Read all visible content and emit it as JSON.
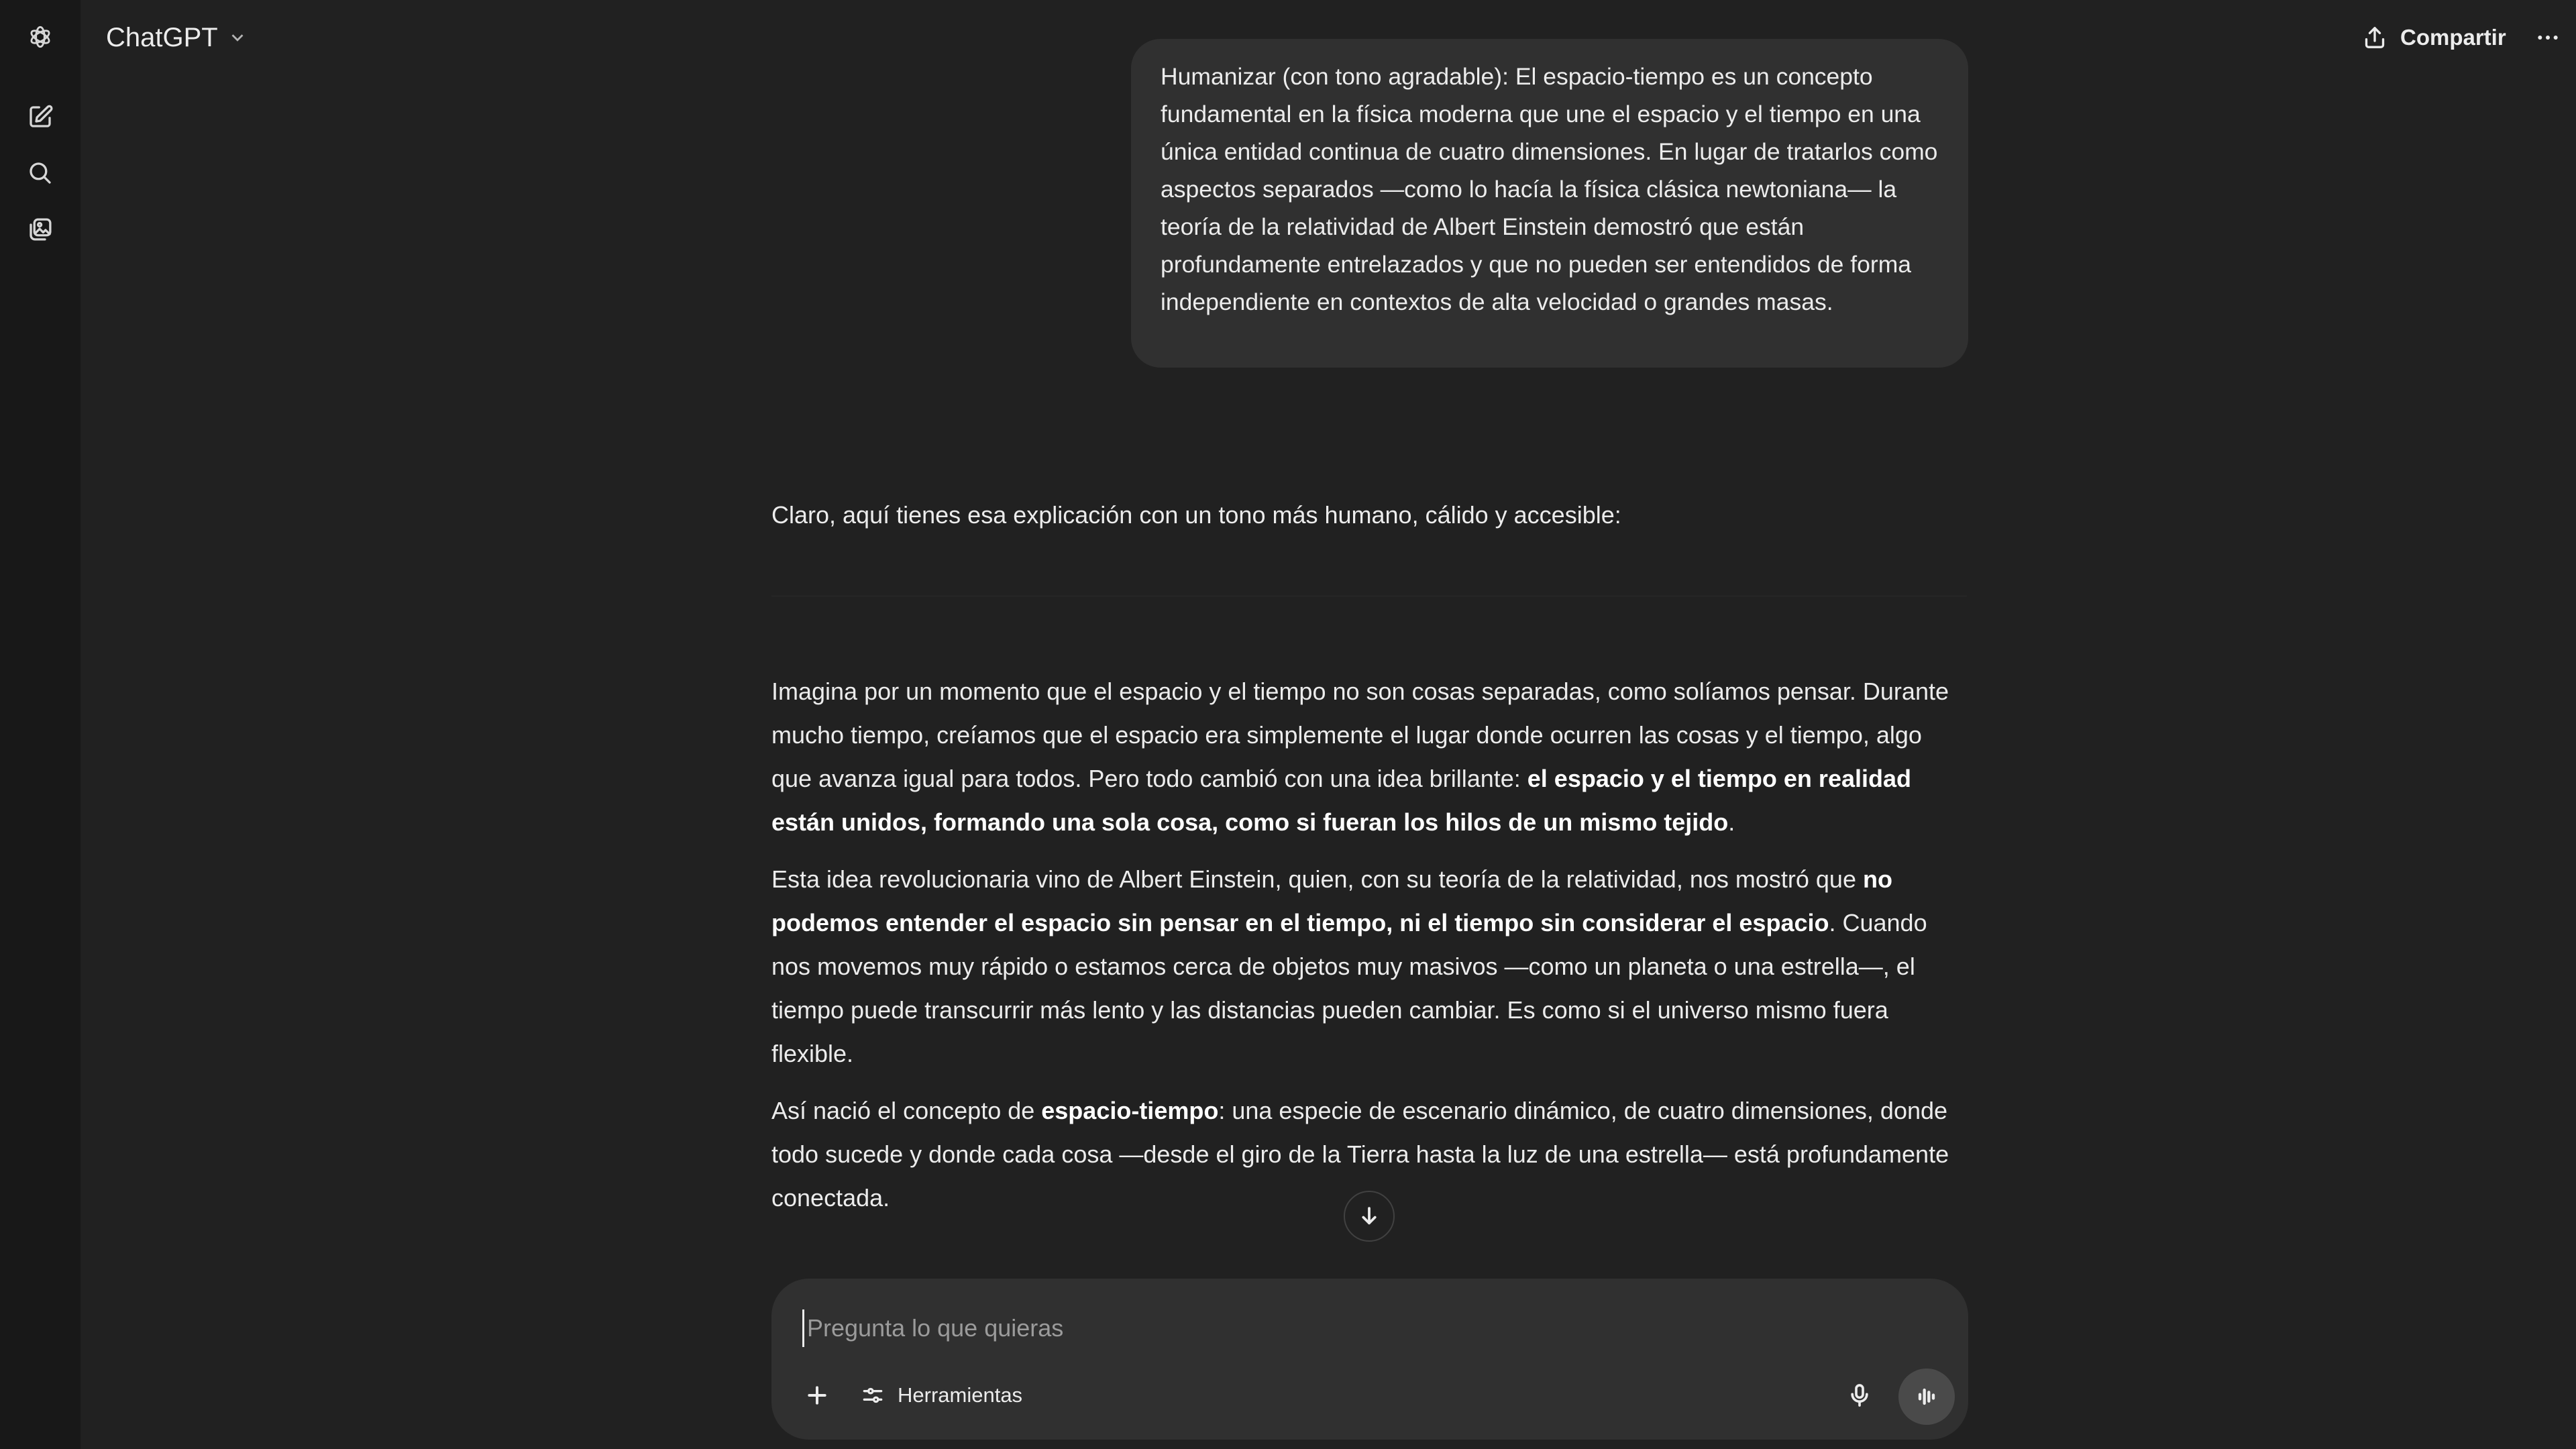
{
  "header": {
    "title": "ChatGPT",
    "share_label": "Compartir",
    "icons": {
      "logo": "openai-logo-icon",
      "new_chat": "edit-pencil-icon",
      "search": "search-icon",
      "library": "image-library-icon",
      "share": "upload-share-icon",
      "more": "more-dots-icon",
      "chevron": "chevron-down-icon"
    }
  },
  "conversation": {
    "user_message": "Humanizar (con tono agradable): El espacio-tiempo es un concepto fundamental en la física moderna que une el espacio y el tiempo en una única entidad continua de cuatro dimensiones. En lugar de tratarlos como aspectos separados —como lo hacía la física clásica newtoniana— la teoría de la relatividad de Albert Einstein demostró que están profundamente entrelazados y que no pueden ser entendidos de forma independiente en contextos de alta velocidad o grandes masas.",
    "assistant_intro": "Claro, aquí tienes esa explicación con un tono más humano, cálido y accesible:",
    "p1": {
      "t1": "Imagina por un momento que el espacio y el tiempo no son cosas separadas, como solíamos pensar. Durante mucho tiempo, creíamos que el espacio era simplemente el lugar donde ocurren las cosas y el tiempo, algo que avanza igual para todos. Pero todo cambió con una idea brillante: ",
      "b1": "el espacio y el tiempo en realidad están unidos, formando una sola cosa, como si fueran los hilos de un mismo tejido",
      "t2": "."
    },
    "p2": {
      "t1": "Esta idea revolucionaria vino de Albert Einstein, quien, con su teoría de la relatividad, nos mostró que ",
      "b1": "no podemos entender el espacio sin pensar en el tiempo, ni el tiempo sin considerar el espacio",
      "t2": ". Cuando nos movemos muy rápido o estamos cerca de objetos muy masivos —como un planeta o una estrella—, el tiempo puede transcurrir más lento y las distancias pueden cambiar. Es como si el universo mismo fuera flexible."
    },
    "p3": {
      "t1": "Así nació el concepto de ",
      "b1": "espacio-tiempo",
      "t2": ": una especie de escenario dinámico, de cuatro dimensiones, donde todo sucede y donde cada cosa —desde el giro de la Tierra hasta la luz de una estrella— está profundamente conectada."
    }
  },
  "composer": {
    "placeholder": "Pregunta lo que quieras",
    "tools_label": "Herramientas",
    "icons": {
      "add": "plus-icon",
      "tools": "sliders-icon",
      "mic": "microphone-icon",
      "voice": "voice-mode-icon",
      "scroll": "arrow-down-icon"
    }
  },
  "colors": {
    "background": "#212121",
    "sidebar": "#181818",
    "bubble": "#303030",
    "text": "#ececec"
  }
}
